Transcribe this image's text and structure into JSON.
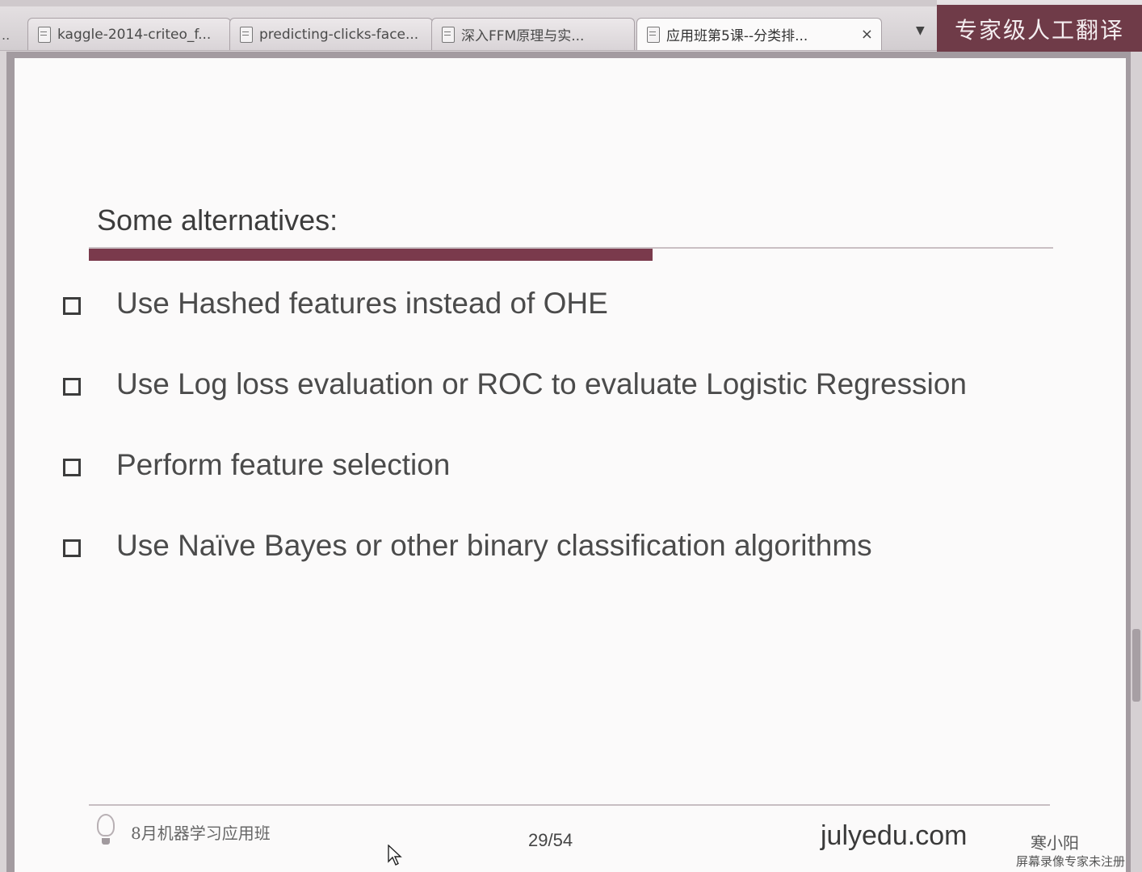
{
  "tabs": [
    {
      "label": "kaggle-2014-criteo_f...",
      "active": false
    },
    {
      "label": "predicting-clicks-face...",
      "active": false
    },
    {
      "label": "深入FFM原理与实...",
      "active": false
    },
    {
      "label": "应用班第5课--分类排...",
      "active": true
    }
  ],
  "tab_overflow": "..",
  "tab_close_glyph": "×",
  "tab_dropdown_glyph": "▼",
  "banner_text": "专家级人工翻译",
  "slide": {
    "title": "Some alternatives:",
    "bullets": [
      "Use Hashed features instead of OHE",
      "Use Log loss evaluation or ROC to evaluate Logistic Regression",
      "Perform feature selection",
      "Use Naïve Bayes or other binary classification algorithms"
    ],
    "footer": {
      "course": "8月机器学习应用班",
      "page": "29/54",
      "site": "julyedu.com",
      "presenter": "寒小阳"
    },
    "accent_color": "#7a3a4c"
  },
  "watermark": "屏幕录像专家未注册"
}
